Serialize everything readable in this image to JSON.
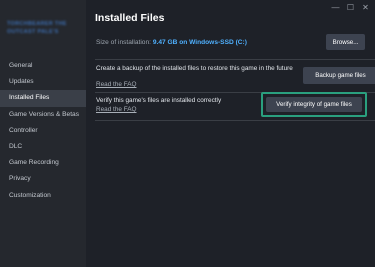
{
  "sidebar": {
    "game_title": "TORCHBEARER THE OUTCAST PALE'S",
    "items": [
      {
        "label": "General"
      },
      {
        "label": "Updates"
      },
      {
        "label": "Installed Files"
      },
      {
        "label": "Game Versions & Betas"
      },
      {
        "label": "Controller"
      },
      {
        "label": "DLC"
      },
      {
        "label": "Game Recording"
      },
      {
        "label": "Privacy"
      },
      {
        "label": "Customization"
      }
    ],
    "active_index": 2
  },
  "window_controls": {
    "minimize_icon": "minimize-icon",
    "maximize_icon": "maximize-icon",
    "close_icon": "close-icon",
    "minimize_glyph": "—",
    "maximize_glyph": "☐",
    "close_glyph": "✕"
  },
  "main": {
    "title": "Installed Files",
    "size_label": "Size of installation:",
    "size_value": "9.47 GB on Windows-SSD (C:)",
    "browse_label": "Browse...",
    "backup": {
      "text": "Create a backup of the installed files to restore this game in the future",
      "faq": "Read the FAQ",
      "button": "Backup game files"
    },
    "verify": {
      "text": "Verify this game's files are installed correctly",
      "faq": "Read the FAQ",
      "button": "Verify integrity of game files"
    }
  },
  "colors": {
    "background": "#1e2128",
    "sidebar": "#25282e",
    "accent_link": "#4fb1ff",
    "highlight": "#2aa07f",
    "button": "#3d4350"
  }
}
